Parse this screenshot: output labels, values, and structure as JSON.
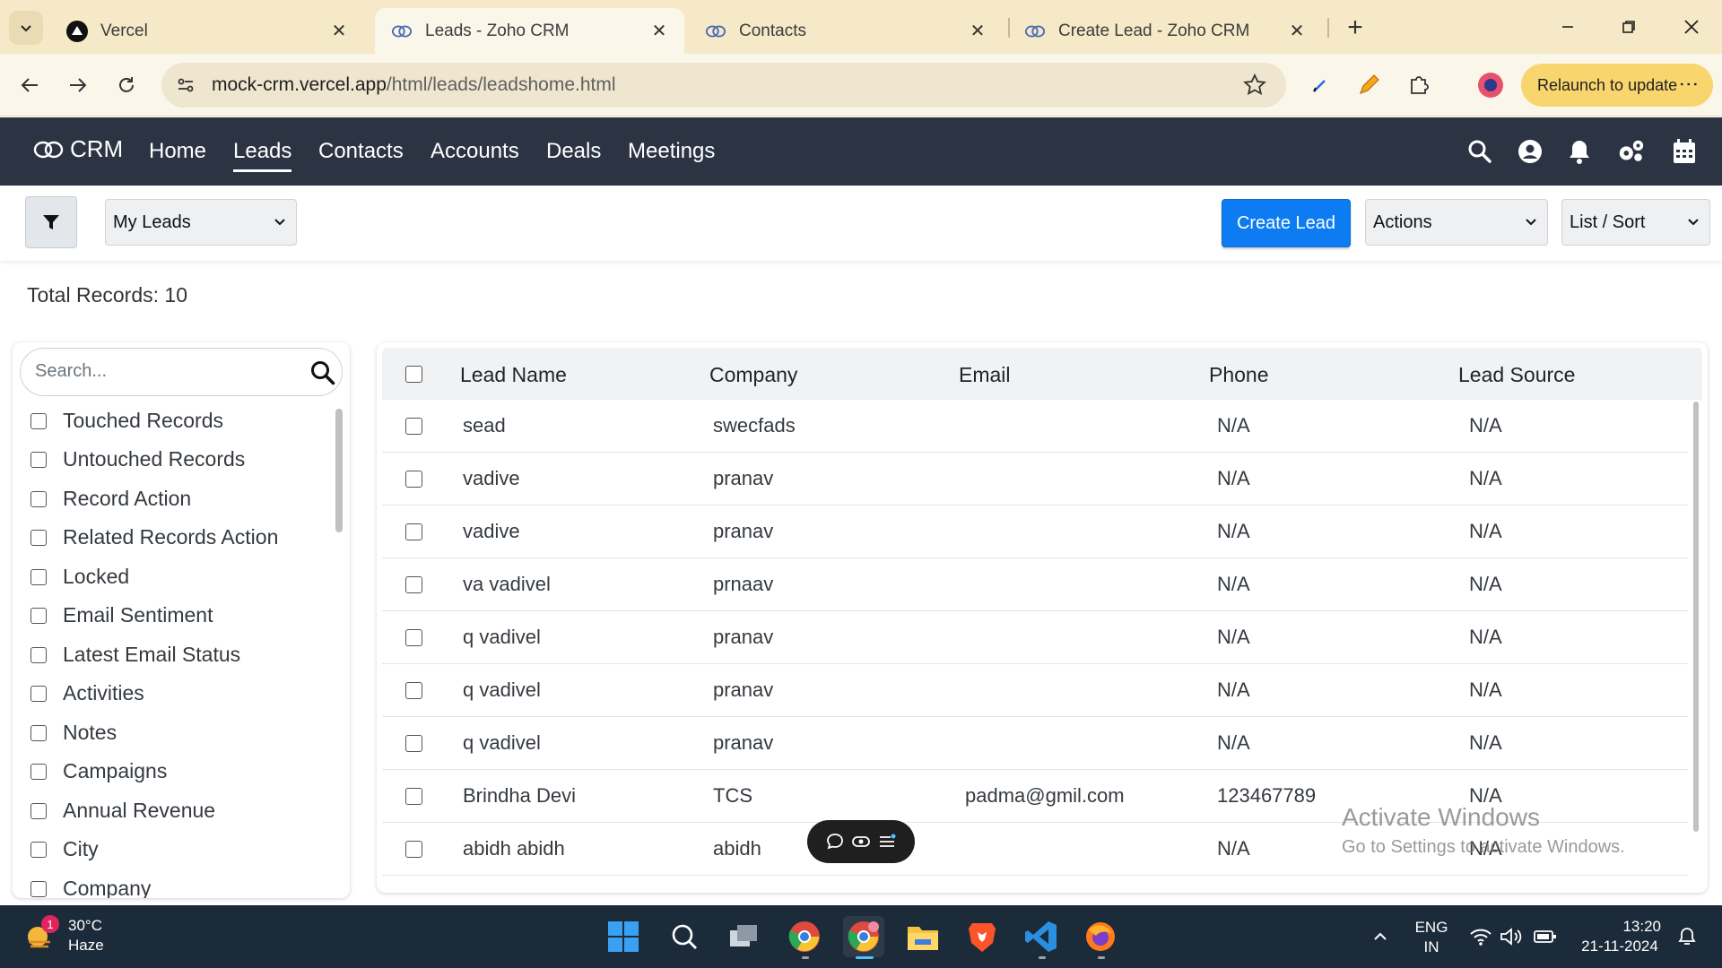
{
  "browser": {
    "tabs": [
      {
        "title": "Vercel",
        "active": false
      },
      {
        "title": "Leads - Zoho CRM",
        "active": true
      },
      {
        "title": "Contacts",
        "active": false
      },
      {
        "title": "Create Lead - Zoho CRM",
        "active": false
      }
    ],
    "url_host": "mock-crm.vercel.app",
    "url_path": "/html/leads/leadshome.html",
    "relaunch_label": "Relaunch to update"
  },
  "crm": {
    "logo": "CRM",
    "nav": [
      "Home",
      "Leads",
      "Contacts",
      "Accounts",
      "Deals",
      "Meetings"
    ],
    "active_nav": "Leads"
  },
  "toolbar": {
    "view_select": "My Leads",
    "create_label": "Create Lead",
    "actions_select": "Actions",
    "list_sort_select": "List / Sort"
  },
  "total_records": "Total Records: 10",
  "sidebar": {
    "search_placeholder": "Search...",
    "filters": [
      "Touched Records",
      "Untouched Records",
      "Record Action",
      "Related Records Action",
      "Locked",
      "Email Sentiment",
      "Latest Email Status",
      "Activities",
      "Notes",
      "Campaigns",
      "Annual Revenue",
      "City",
      "Company"
    ]
  },
  "table": {
    "headers": [
      "Lead Name",
      "Company",
      "Email",
      "Phone",
      "Lead Source"
    ],
    "rows": [
      {
        "name": "sead",
        "company": "swecfads",
        "email": "",
        "phone": "N/A",
        "source": "N/A"
      },
      {
        "name": "vadive",
        "company": "pranav",
        "email": "",
        "phone": "N/A",
        "source": "N/A"
      },
      {
        "name": "vadive",
        "company": "pranav",
        "email": "",
        "phone": "N/A",
        "source": "N/A"
      },
      {
        "name": "va vadivel",
        "company": "prnaav",
        "email": "",
        "phone": "N/A",
        "source": "N/A"
      },
      {
        "name": "q vadivel",
        "company": "pranav",
        "email": "",
        "phone": "N/A",
        "source": "N/A"
      },
      {
        "name": "q vadivel",
        "company": "pranav",
        "email": "",
        "phone": "N/A",
        "source": "N/A"
      },
      {
        "name": "q vadivel",
        "company": "pranav",
        "email": "",
        "phone": "N/A",
        "source": "N/A"
      },
      {
        "name": "Brindha Devi",
        "company": "TCS",
        "email": "padma@gmil.com",
        "phone": "123467789",
        "source": "N/A"
      },
      {
        "name": "abidh abidh",
        "company": "abidh",
        "email": "",
        "phone": "N/A",
        "source": "N/A"
      }
    ]
  },
  "watermark": {
    "line1": "Activate Windows",
    "line2": "Go to Settings to activate Windows."
  },
  "taskbar": {
    "weather_temp": "30°C",
    "weather_desc": "Haze",
    "weather_badge": "1",
    "lang_top": "ENG",
    "lang_bottom": "IN",
    "time": "13:20",
    "date": "21-11-2024"
  },
  "colors": {
    "nav_bg": "#2c3444",
    "primary": "#0d7cf2",
    "tabbar_bg": "#f5e9c7",
    "taskbar_bg": "#1c2b3a"
  }
}
